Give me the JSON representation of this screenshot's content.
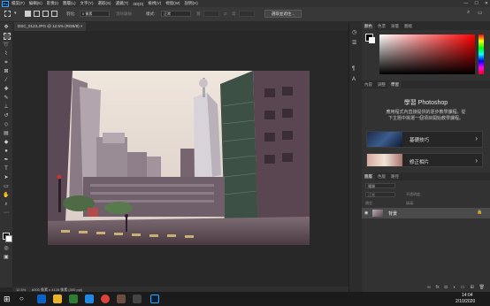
{
  "app": {
    "logo_text": "Ps",
    "menu": [
      "檔案(F)",
      "編輯(E)",
      "影像(I)",
      "圖層(L)",
      "文字(Y)",
      "選取(S)",
      "濾鏡(T)",
      "3D(D)",
      "檢視(V)",
      "視窗(W)",
      "說明(H)"
    ],
    "window_controls": {
      "minimize": "—",
      "maximize": "☐",
      "close": "✕"
    }
  },
  "options": {
    "feather_label": "羽化:",
    "feather_value": "0 像素",
    "antialias_label": "消除鋸齒",
    "style_label": "樣式:",
    "style_value": "正常",
    "width_label": "寬:",
    "height_label": "高:",
    "select_mask_button": "選取並遮住..."
  },
  "document": {
    "tab_title": "DSC_0123.JPG @ 12.5% (RGB/8) ×",
    "status_zoom": "12.5%",
    "status_info": "6000 像素 x 4128 像素 (300 ppi)"
  },
  "panels": {
    "color_tabs": [
      "顏色",
      "色票",
      "漸層",
      "圖樣"
    ],
    "learn_tabs": [
      "內容",
      "調整",
      "學習"
    ],
    "learn_title": "學習 Photoshop",
    "learn_desc_line1": "應用程式內直接提供的逐步教學課程。從",
    "learn_desc_line2": "下主題中挑選一個項目開始教學課程。",
    "card1_label": "基礎技巧",
    "card2_label": "修正相片",
    "layers_tabs": [
      "圖層",
      "色版",
      "路徑"
    ],
    "layer_kind_label": "種類",
    "blend_mode": "正常",
    "opacity_label": "不透明度:",
    "fill_label": "填滿:",
    "lock_label": "鎖定:",
    "layer_name": "背景"
  },
  "taskbar": {
    "time": "14:04",
    "date": "2/10/2020"
  },
  "colors": {
    "accent": "#31a8ff",
    "foreground_swatch": "#000000",
    "background_swatch": "#ffffff"
  },
  "icons": {
    "windows_start": "windows-icon",
    "search": "search-icon",
    "photoshop": "photoshop-icon"
  }
}
